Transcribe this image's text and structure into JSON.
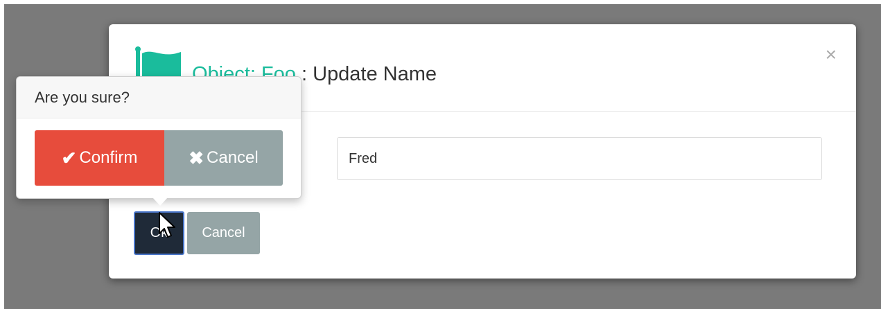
{
  "modal": {
    "title_object": "Object: Foo",
    "title_separator": " : ",
    "title_action": "Update Name",
    "close_label": "×",
    "name_value": "Fred",
    "ok_label": "Ok",
    "cancel_label": "Cancel",
    "icon": "flag-icon"
  },
  "popover": {
    "title": "Are you sure?",
    "confirm_label": "Confirm",
    "confirm_icon": "check-icon",
    "cancel_label": "Cancel",
    "cancel_icon": "x-icon"
  },
  "colors": {
    "backdrop": "#7a7a7a",
    "accent": "#1abc9c",
    "danger": "#e74c3c",
    "muted": "#95a5a6",
    "primary_dark": "#1f2a38"
  }
}
